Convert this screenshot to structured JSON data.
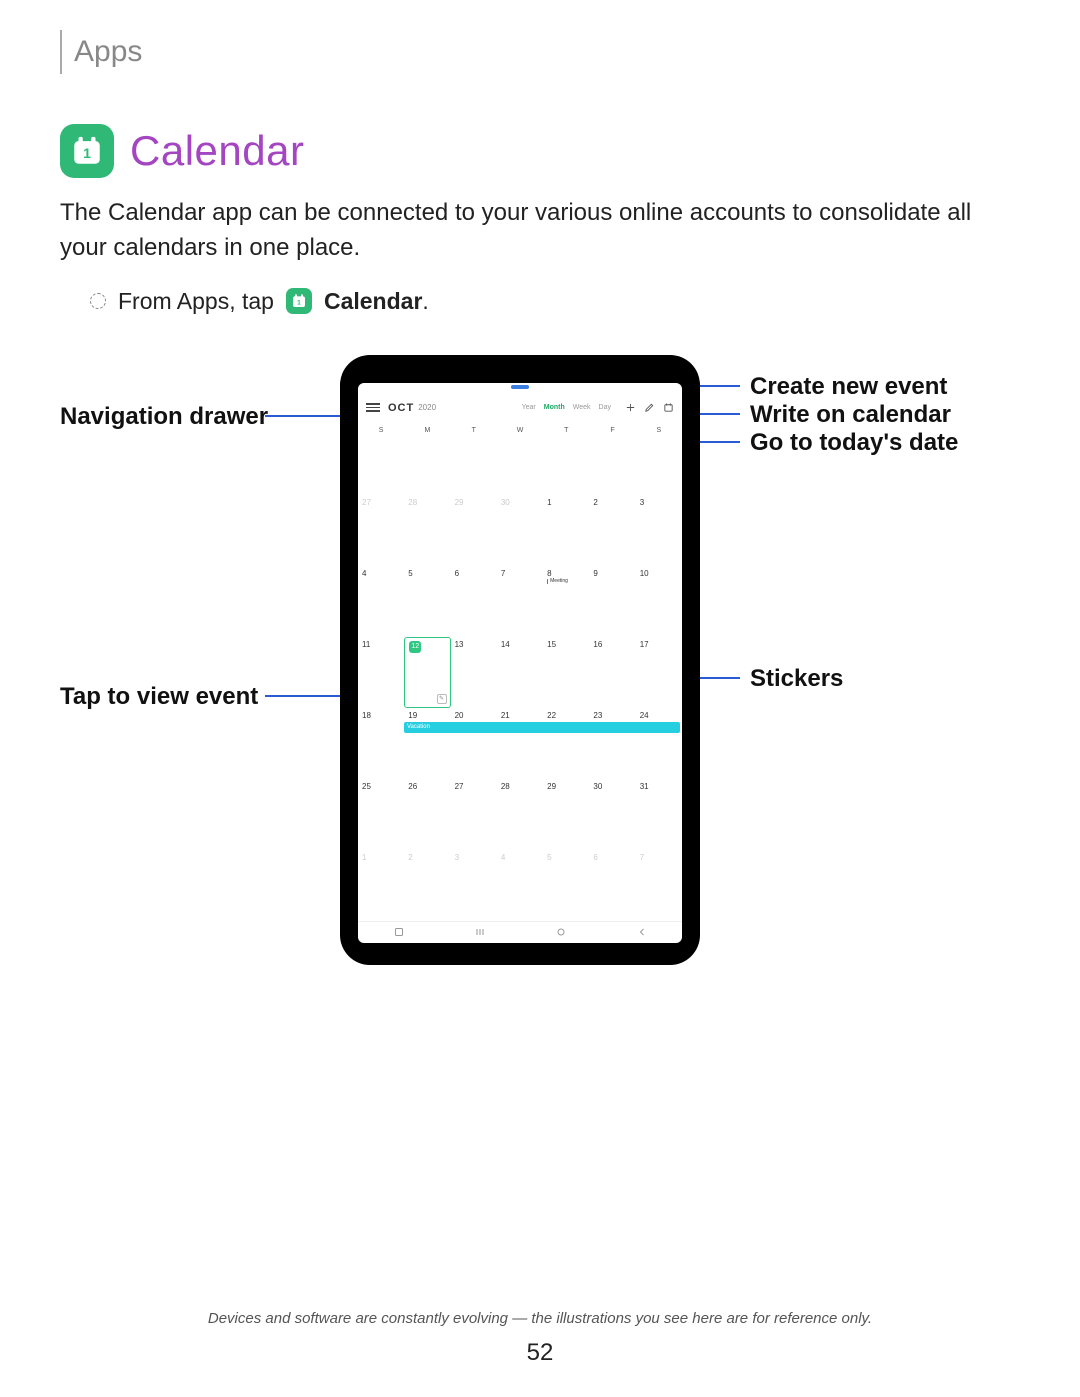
{
  "breadcrumb": "Apps",
  "section": {
    "title": "Calendar",
    "intro": "The Calendar app can be connected to your various online accounts to consolidate all your calendars in one place.",
    "step_prefix": "From Apps, tap",
    "step_app": "Calendar",
    "step_suffix": "."
  },
  "callouts": {
    "nav_drawer": "Navigation drawer",
    "tap_view": "Tap to view event",
    "create": "Create new event",
    "write": "Write on calendar",
    "today": "Go to today's date",
    "stickers": "Stickers"
  },
  "calendar": {
    "month": "OCT",
    "year": "2020",
    "tabs": {
      "year": "Year",
      "month": "Month",
      "week": "Week",
      "day": "Day"
    },
    "dow": [
      "S",
      "M",
      "T",
      "W",
      "T",
      "F",
      "S"
    ],
    "prev_trail": [
      "27",
      "28",
      "29",
      "30"
    ],
    "selected": "12",
    "meeting_label": "Meeting",
    "event_label": "Vacation",
    "next_lead": [
      "1",
      "2",
      "3",
      "4",
      "5",
      "6",
      "7"
    ]
  },
  "footer": "Devices and software are constantly evolving — the illustrations you see here are for reference only.",
  "page": "52"
}
